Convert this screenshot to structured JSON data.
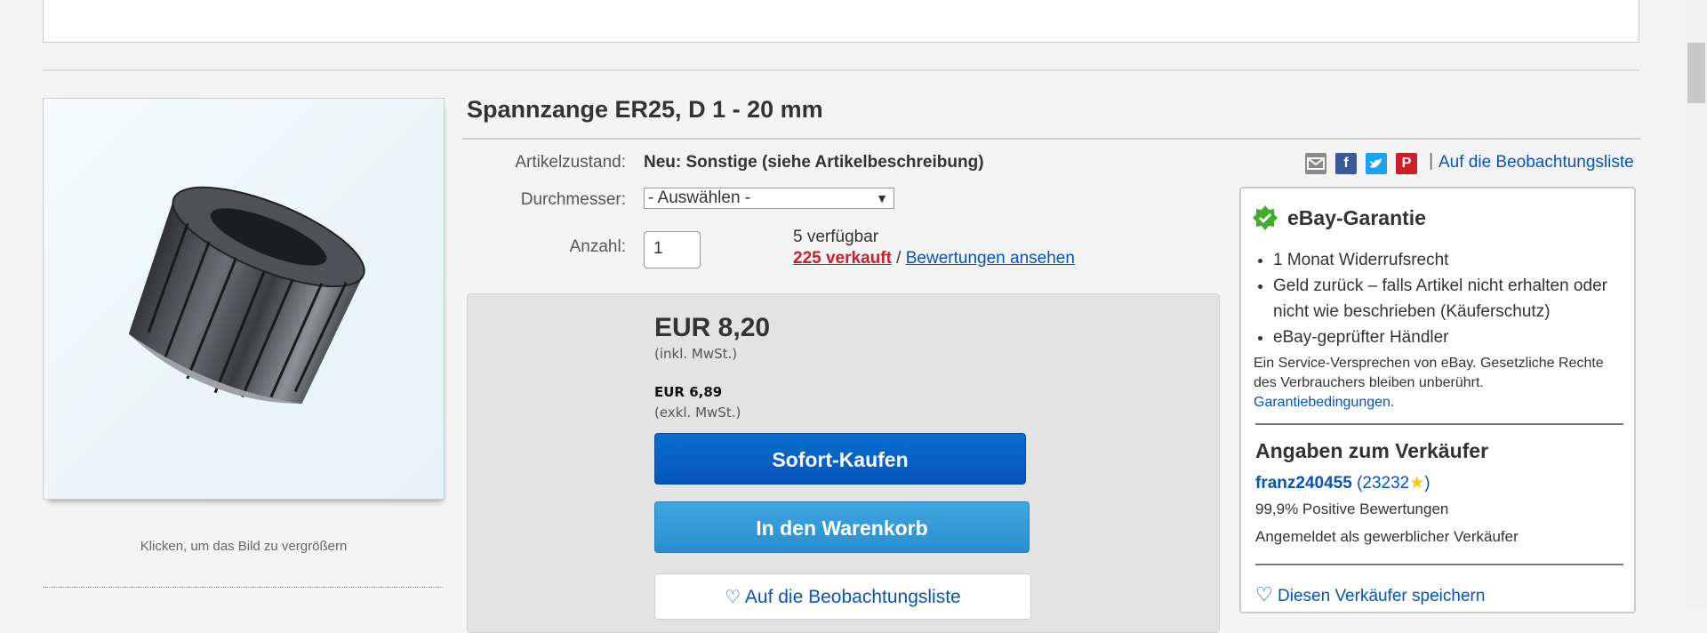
{
  "product": {
    "title": "Spannzange ER25, D 1 - 20 mm",
    "image_caption": "Klicken, um das Bild zu vergrößern"
  },
  "details": {
    "condition_label": "Artikelzustand:",
    "condition_value": "Neu: Sonstige (siehe Artikelbeschreibung)",
    "diameter_label": "Durchmesser:",
    "diameter_selected": "- Auswählen -",
    "quantity_label": "Anzahl:",
    "quantity_value": "1",
    "available": "5 verfügbar",
    "sold": "225 verkauft",
    "sold_separator": " / ",
    "reviews_link": "Bewertungen ansehen"
  },
  "pricing": {
    "price": "EUR 8,20",
    "price_note": "(inkl. MwSt.)",
    "net_price": "EUR 6,89",
    "net_note": "(exkl. MwSt.)",
    "buy_now": "Sofort-Kaufen",
    "add_to_cart": "In den Warenkorb",
    "watch": "Auf die Beobachtungsliste"
  },
  "share": {
    "separator": "|",
    "watch_link": "Auf die Beobachtungsliste",
    "icons": [
      "email-icon",
      "facebook-icon",
      "twitter-icon",
      "pinterest-icon"
    ]
  },
  "guarantee": {
    "title": "eBay-Garantie",
    "items": [
      "1 Monat Widerrufsrecht",
      "Geld zurück – falls Artikel nicht erhalten oder nicht wie beschrieben (Käuferschutz)",
      "eBay-geprüfter Händler"
    ],
    "fine_print": "Ein Service-Versprechen von eBay. Gesetzliche Rechte des Verbrauchers bleiben unberührt.",
    "terms_link": "Garantiebedingungen"
  },
  "seller": {
    "heading": "Angaben zum Verkäufer",
    "name": "franz240455",
    "score": "23232",
    "positive": "99,9% Positive Bewertungen",
    "registered": "Angemeldet als gewerblicher Verkäufer",
    "save": "Diesen Verkäufer speichern"
  },
  "colors": {
    "link": "#0654ba",
    "sold": "#c3232f",
    "buy_button": "#0654ba",
    "cart_button": "#2a8ed0"
  }
}
